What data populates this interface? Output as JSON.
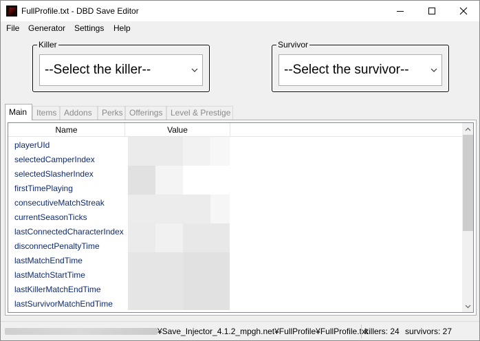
{
  "window": {
    "title": "FullProfile.txt - DBD Save Editor",
    "icon": "app-icon"
  },
  "menu": {
    "items": [
      "File",
      "Generator",
      "Settings",
      "Help"
    ]
  },
  "killer": {
    "legend": "Killer",
    "selected": "--Select the killer--"
  },
  "survivor": {
    "legend": "Survivor",
    "selected": "--Select the survivor--"
  },
  "tabs": [
    "Main",
    "Items",
    "Addons",
    "Perks",
    "Offerings",
    "Level & Prestige"
  ],
  "grid": {
    "columns": [
      "Name",
      "Value"
    ],
    "rows": [
      {
        "name": "playerUId"
      },
      {
        "name": "selectedCamperIndex"
      },
      {
        "name": "selectedSlasherIndex"
      },
      {
        "name": "firstTimePlaying"
      },
      {
        "name": "consecutiveMatchStreak"
      },
      {
        "name": "currentSeasonTicks"
      },
      {
        "name": "lastConnectedCharacterIndex"
      },
      {
        "name": "disconnectPenaltyTime"
      },
      {
        "name": "lastMatchEndTime"
      },
      {
        "name": "lastMatchStartTime"
      },
      {
        "name": "lastKillerMatchEndTime"
      },
      {
        "name": "lastSurvivorMatchEndTime"
      }
    ]
  },
  "status": {
    "path": "¥Save_Injector_4.1.2_mpgh.net¥FullProfile¥FullProfile.txt",
    "killers": "killers: 24",
    "survivors": "survivors: 27"
  }
}
